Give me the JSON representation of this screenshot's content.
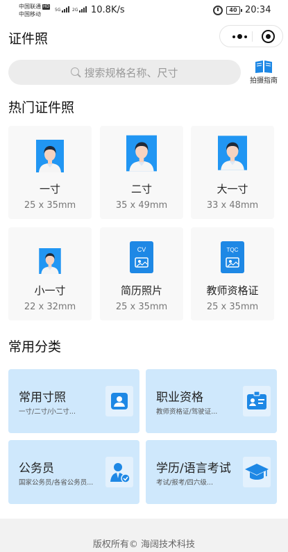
{
  "status_bar": {
    "carrier_1": "中国联通",
    "carrier_1_badge": "HD",
    "carrier_2": "中国移动",
    "network_1": "5G",
    "network_2": "2G",
    "speed": "10.8K/s",
    "battery": "40",
    "time": "20:34"
  },
  "nav": {
    "title": "证件照",
    "more_icon": "more-dots-icon",
    "close_icon": "target-close-icon"
  },
  "search": {
    "placeholder": "搜索规格名称、尺寸",
    "guide_label": "拍摄指南",
    "guide_icon": "open-book-icon"
  },
  "hot": {
    "title": "热门证件照",
    "items": [
      {
        "name": "一寸",
        "size": "25 x 35mm",
        "icon": "portrait-photo-icon"
      },
      {
        "name": "二寸",
        "size": "35 x 49mm",
        "icon": "portrait-photo-icon"
      },
      {
        "name": "大一寸",
        "size": "33 x 48mm",
        "icon": "portrait-photo-icon"
      },
      {
        "name": "小一寸",
        "size": "22 x 32mm",
        "icon": "portrait-photo-icon"
      },
      {
        "name": "简历照片",
        "size": "25 x 35mm",
        "icon": "cv-doc-icon",
        "badge": "CV"
      },
      {
        "name": "教师资格证",
        "size": "25 x 35mm",
        "icon": "tqc-doc-icon",
        "badge": "TQC"
      }
    ]
  },
  "categories": {
    "title": "常用分类",
    "items": [
      {
        "title": "常用寸照",
        "subtitle": "一寸/二寸/小二寸...",
        "icon": "person-card-icon"
      },
      {
        "title": "职业资格",
        "subtitle": "教师资格证/驾驶证...",
        "icon": "id-badge-icon"
      },
      {
        "title": "公务员",
        "subtitle": "国家公务员/各省公务员...",
        "icon": "official-person-icon"
      },
      {
        "title": "学历/语言考试",
        "subtitle": "考试/报考/四六级...",
        "icon": "graduation-cap-icon"
      }
    ]
  },
  "footer": {
    "text": "版权所有© 海阔技术科技"
  },
  "colors": {
    "accent": "#1e88e5",
    "photo_bg": "#2196f3",
    "category_bg": "#cfe8fc",
    "search_bg": "#ececec"
  }
}
